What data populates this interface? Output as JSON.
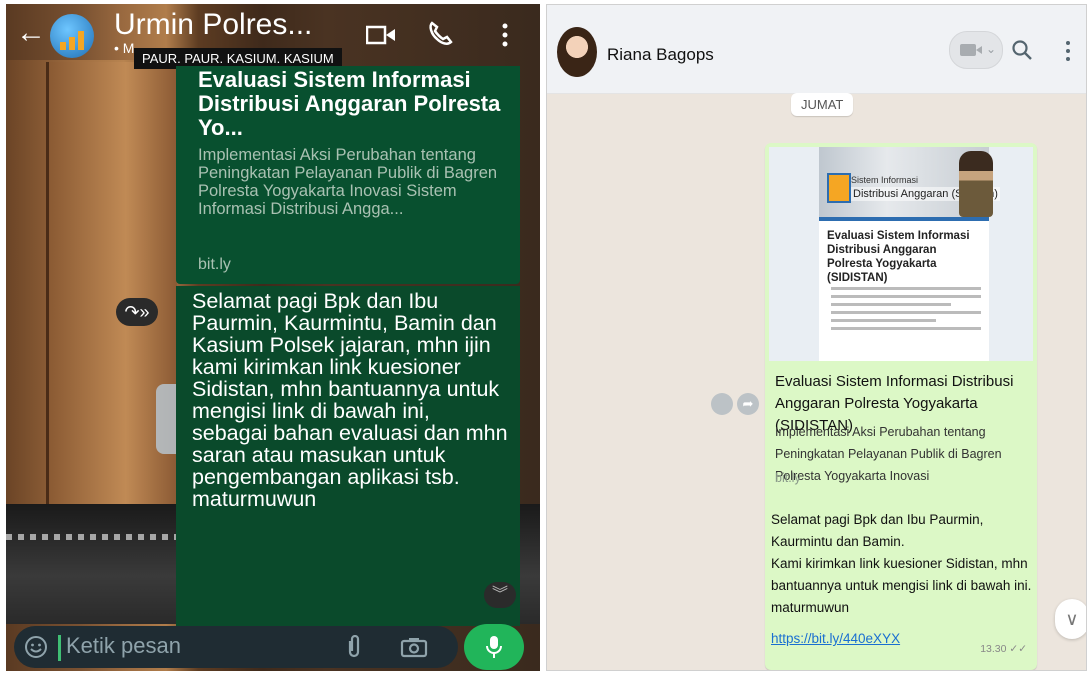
{
  "left": {
    "contact_name": "Urmin Polres...",
    "subtitle": "• M",
    "tooltip": "PAUR. PAUR. KASIUM. KASIUM",
    "preview": {
      "title": "Evaluasi Sistem Informasi Distribusi Anggaran Polresta Yo...",
      "description": "Implementasi Aksi Perubahan tentang Peningkatan Pelayanan Publik di Bagren Polresta Yogyakarta Inovasi Sistem Informasi Distribusi Angga...",
      "link": "bit.ly"
    },
    "message": "Selamat pagi Bpk dan Ibu Paurmin, Kaurmintu, Bamin dan Kasium Polsek jajaran, mhn ijin kami kirimkan link kuesioner Sidistan, mhn bantuannya untuk mengisi link di bawah ini, sebagai bahan evaluasi dan mhn saran atau masukan untuk pengembangan aplikasi tsb. maturmuwun",
    "input_placeholder": "Ketik pesan",
    "forward_glyph": "↷»",
    "scroll_glyph": "︾",
    "back_glyph": "←"
  },
  "right": {
    "contact_name": "Riana Bagops",
    "day_label": "JUMAT",
    "thumbnail": {
      "banner_line1": "Sistem Informasi",
      "banner_line2": "Distribusi Anggaran (Sidistan)",
      "form_title": "Evaluasi Sistem Informasi Distribusi Anggaran Polresta Yogyakarta (SIDISTAN)"
    },
    "preview": {
      "title": "Evaluasi Sistem Informasi Distribusi Anggaran Polresta Yogyakarta (SIDISTAN)",
      "description": "Implementasi Aksi Perubahan tentang Peningkatan Pelayanan Publik di Bagren Polresta Yogyakarta Inovasi",
      "link": "bit.ly"
    },
    "message_lines": [
      "Selamat pagi Bpk dan Ibu Paurmin, Kaurmintu dan Bamin.",
      "Kami kirimkan link kuesioner Sidistan, mhn bantuannya untuk mengisi link di bawah ini.",
      "maturmuwun"
    ],
    "url": "https://bit.ly/440eXYX",
    "time": "13.30 ✓✓",
    "scroll_glyph": "∨",
    "share_glyph": "➦"
  },
  "colors": {
    "dark_bubble": "#08502f",
    "light_bubble": "#dcf8c6",
    "mic_green": "#21b55a",
    "link_blue": "#1a6fd1"
  }
}
